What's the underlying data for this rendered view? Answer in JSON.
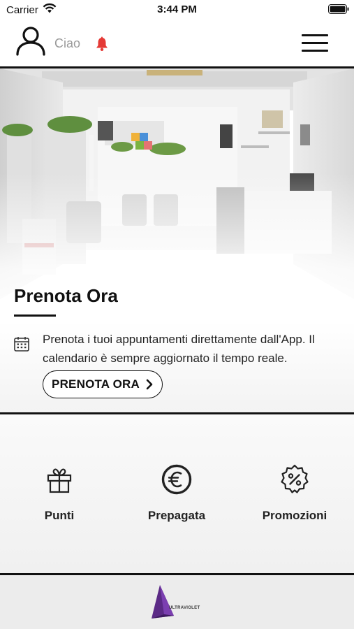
{
  "status_bar": {
    "carrier": "Carrier",
    "time": "3:44 PM"
  },
  "header": {
    "greeting": "Ciao",
    "icons": [
      "user-icon",
      "bell-icon",
      "hamburger-menu-icon"
    ],
    "bell_color": "#e53935"
  },
  "hero": {
    "title": "Prenota Ora",
    "description": "Prenota i tuoi appuntamenti direttamente dall'App. Il calendario è sempre aggiornato il tempo reale.",
    "button_label": "PRENOTA ORA",
    "icons": [
      "calendar-icon",
      "chevron-right-icon"
    ]
  },
  "features": [
    {
      "label": "Punti",
      "icon": "gift-icon"
    },
    {
      "label": "Prepagata",
      "icon": "euro-icon"
    },
    {
      "label": "Promozioni",
      "icon": "discount-badge-icon"
    }
  ],
  "footer": {
    "brand": "ULTRAVIOLET",
    "brand_color": "#5b2a86"
  }
}
